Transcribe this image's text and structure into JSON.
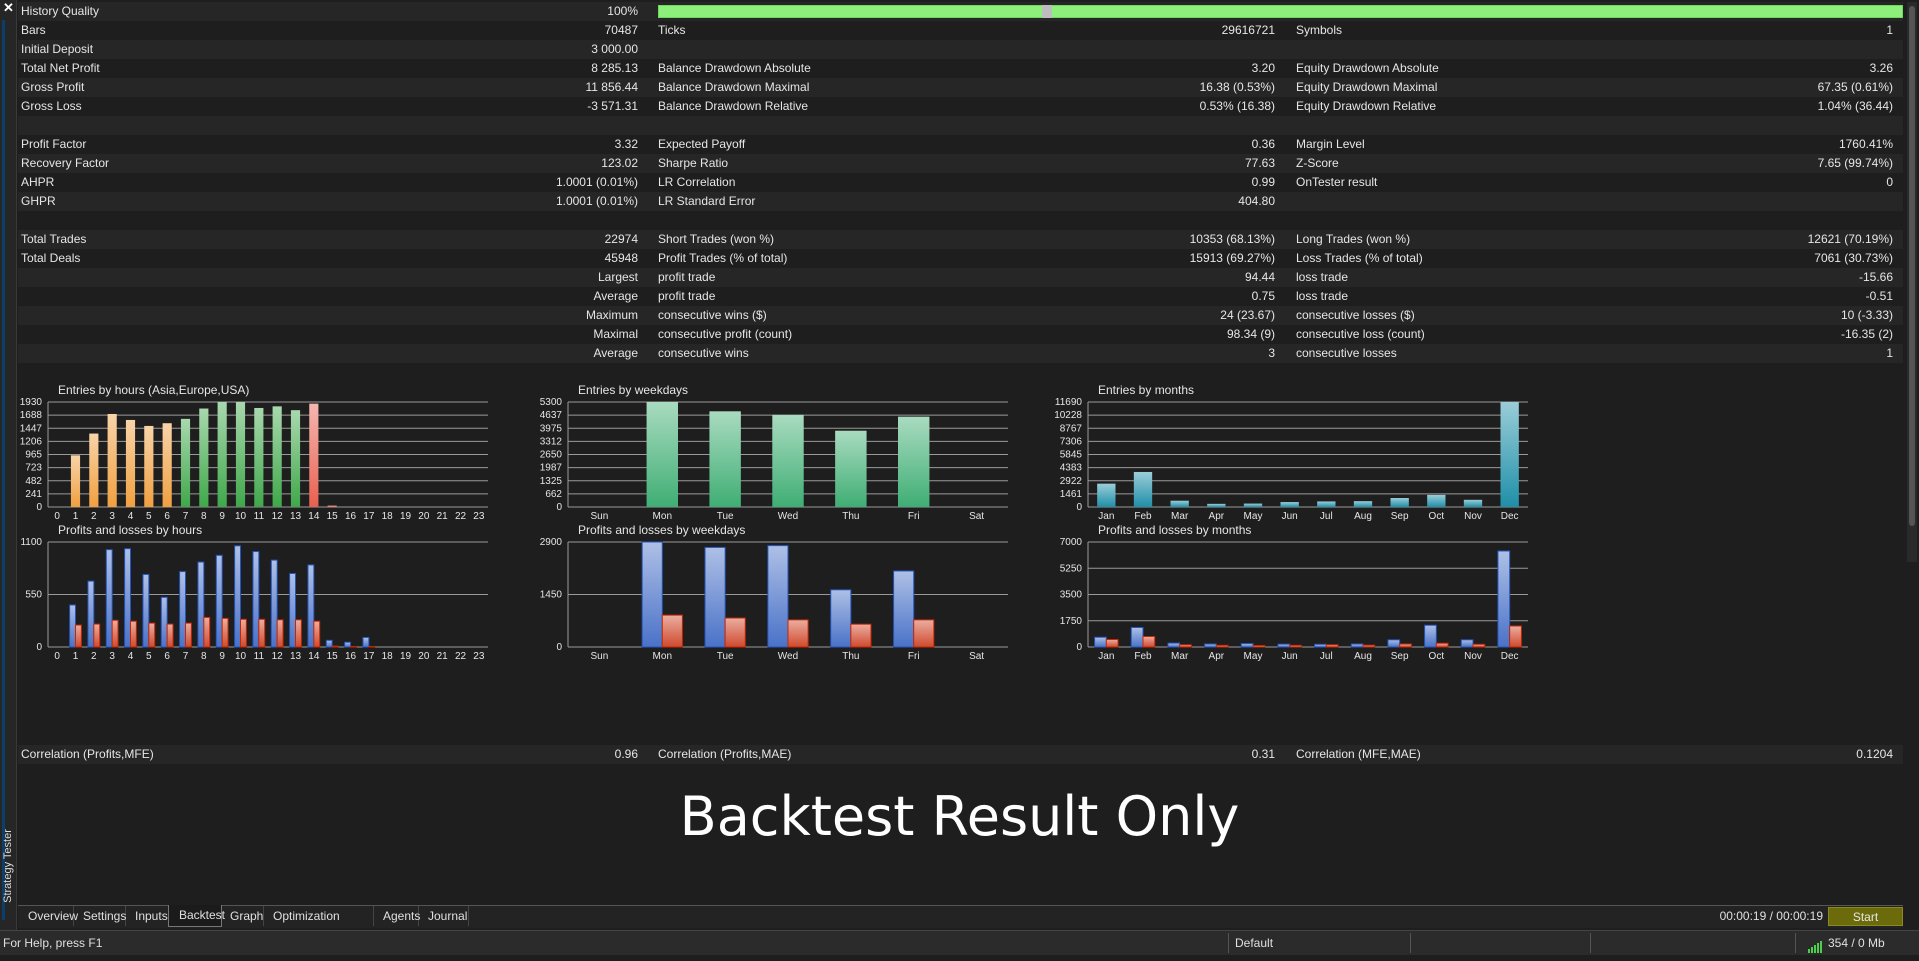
{
  "window": {
    "title": "Strategy Tester",
    "close_glyph": "✕"
  },
  "stats": {
    "rows": [
      {
        "cells": [
          "History Quality",
          "100%",
          "",
          "",
          "",
          ""
        ],
        "alt": true,
        "quality_bar": true,
        "quality_pct": 100
      },
      {
        "cells": [
          "Bars",
          "70487",
          "Ticks",
          "29616721",
          "Symbols",
          "1"
        ],
        "alt": false
      },
      {
        "cells": [
          "Initial Deposit",
          "3 000.00",
          "",
          "",
          "",
          ""
        ],
        "alt": true
      },
      {
        "cells": [
          "Total Net Profit",
          "8 285.13",
          "Balance Drawdown Absolute",
          "3.20",
          "Equity Drawdown Absolute",
          "3.26"
        ],
        "alt": false
      },
      {
        "cells": [
          "Gross Profit",
          "11 856.44",
          "Balance Drawdown Maximal",
          "16.38 (0.53%)",
          "Equity Drawdown Maximal",
          "67.35 (0.61%)"
        ],
        "alt": true
      },
      {
        "cells": [
          "Gross Loss",
          "-3 571.31",
          "Balance Drawdown Relative",
          "0.53% (16.38)",
          "Equity Drawdown Relative",
          "1.04% (36.44)"
        ],
        "alt": false
      },
      {
        "cells": [
          "",
          "",
          "",
          "",
          "",
          ""
        ],
        "alt": true
      },
      {
        "cells": [
          "Profit Factor",
          "3.32",
          "Expected Payoff",
          "0.36",
          "Margin Level",
          "1760.41%"
        ],
        "alt": false
      },
      {
        "cells": [
          "Recovery Factor",
          "123.02",
          "Sharpe Ratio",
          "77.63",
          "Z-Score",
          "7.65 (99.74%)"
        ],
        "alt": true
      },
      {
        "cells": [
          "AHPR",
          "1.0001 (0.01%)",
          "LR Correlation",
          "0.99",
          "OnTester result",
          "0"
        ],
        "alt": false
      },
      {
        "cells": [
          "GHPR",
          "1.0001 (0.01%)",
          "LR Standard Error",
          "404.80",
          "",
          ""
        ],
        "alt": true
      },
      {
        "cells": [
          "",
          "",
          "",
          "",
          "",
          ""
        ],
        "alt": false
      },
      {
        "cells": [
          "Total Trades",
          "22974",
          "Short Trades (won %)",
          "10353 (68.13%)",
          "Long Trades (won %)",
          "12621 (70.19%)"
        ],
        "alt": true
      },
      {
        "cells": [
          "Total Deals",
          "45948",
          "Profit Trades (% of total)",
          "15913 (69.27%)",
          "Loss Trades (% of total)",
          "7061 (30.73%)"
        ],
        "alt": false
      },
      {
        "cells": [
          "",
          "Largest",
          "profit trade",
          "94.44",
          "loss trade",
          "-15.66"
        ],
        "alt": true,
        "right_label": true
      },
      {
        "cells": [
          "",
          "Average",
          "profit trade",
          "0.75",
          "loss trade",
          "-0.51"
        ],
        "alt": false,
        "right_label": true
      },
      {
        "cells": [
          "",
          "Maximum",
          "consecutive wins ($)",
          "24 (23.67)",
          "consecutive losses ($)",
          "10 (-3.33)"
        ],
        "alt": true,
        "right_label": true
      },
      {
        "cells": [
          "",
          "Maximal",
          "consecutive profit (count)",
          "98.34 (9)",
          "consecutive loss (count)",
          "-16.35 (2)"
        ],
        "alt": false,
        "right_label": true
      },
      {
        "cells": [
          "",
          "Average",
          "consecutive wins",
          "3",
          "consecutive losses",
          "1"
        ],
        "alt": true,
        "right_label": true
      },
      {
        "cells": [
          "",
          "",
          "",
          "",
          "",
          ""
        ],
        "alt": false
      }
    ]
  },
  "chart_data": [
    {
      "type": "bar",
      "title": "Entries by hours (Asia,Europe,USA)",
      "categories": [
        "0",
        "1",
        "2",
        "3",
        "4",
        "5",
        "6",
        "7",
        "8",
        "9",
        "10",
        "11",
        "12",
        "13",
        "14",
        "15",
        "16",
        "17",
        "18",
        "19",
        "20",
        "21",
        "22",
        "23"
      ],
      "values": [
        0,
        950,
        1350,
        1710,
        1600,
        1490,
        1540,
        1620,
        1810,
        1930,
        1930,
        1820,
        1850,
        1780,
        1900,
        25,
        0,
        0,
        0,
        0,
        0,
        0,
        0,
        0
      ],
      "yticks": [
        "0",
        "241",
        "482",
        "723",
        "965",
        "1206",
        "1447",
        "1688",
        "1930"
      ],
      "ylim": [
        0,
        1930
      ],
      "colors": [
        "#f0a040",
        "#f0a040",
        "#f0a040",
        "#f0a040",
        "#f0a040",
        "#f0a040",
        "#f0a040",
        "#3fa84a",
        "#3fa84a",
        "#3fa84a",
        "#3fa84a",
        "#3fa84a",
        "#3fa84a",
        "#3fa84a",
        "#e8604f",
        "#e8604f",
        "#e8604f",
        "#e8604f",
        "#e8604f",
        "#e8604f",
        "#e8604f",
        "#e8604f",
        "#e8604f",
        "#e8604f"
      ]
    },
    {
      "type": "bar",
      "title": "Entries by weekdays",
      "categories": [
        "Sun",
        "Mon",
        "Tue",
        "Wed",
        "Thu",
        "Fri",
        "Sat"
      ],
      "values": [
        0,
        5300,
        4830,
        4650,
        3850,
        4560,
        0
      ],
      "yticks": [
        "0",
        "662",
        "1325",
        "1987",
        "2650",
        "3312",
        "3975",
        "4637",
        "5300"
      ],
      "ylim": [
        0,
        5300
      ],
      "colors": [
        "#3fae74",
        "#3fae74",
        "#3fae74",
        "#3fae74",
        "#3fae74",
        "#3fae74",
        "#3fae74"
      ]
    },
    {
      "type": "bar",
      "title": "Entries by months",
      "categories": [
        "Jan",
        "Feb",
        "Mar",
        "Apr",
        "May",
        "Jun",
        "Jul",
        "Aug",
        "Sep",
        "Oct",
        "Nov",
        "Dec"
      ],
      "values": [
        2600,
        3900,
        700,
        350,
        380,
        550,
        620,
        650,
        1000,
        1350,
        800,
        11690
      ],
      "yticks": [
        "0",
        "1461",
        "2922",
        "4383",
        "5845",
        "7306",
        "8767",
        "10228",
        "11690"
      ],
      "ylim": [
        0,
        11690
      ],
      "colors": [
        "#1f8fa8",
        "#1f8fa8",
        "#1f8fa8",
        "#1f8fa8",
        "#1f8fa8",
        "#1f8fa8",
        "#1f8fa8",
        "#1f8fa8",
        "#1f8fa8",
        "#1f8fa8",
        "#1f8fa8",
        "#1f8fa8"
      ]
    },
    {
      "type": "bar",
      "title": "Profits and losses by hours",
      "categories": [
        "0",
        "1",
        "2",
        "3",
        "4",
        "5",
        "6",
        "7",
        "8",
        "9",
        "10",
        "11",
        "12",
        "13",
        "14",
        "15",
        "16",
        "17",
        "18",
        "19",
        "20",
        "21",
        "22",
        "23"
      ],
      "series": [
        {
          "values": [
            0,
            440,
            690,
            1020,
            1030,
            760,
            520,
            790,
            890,
            960,
            1060,
            1000,
            910,
            770,
            860,
            70,
            50,
            100,
            0,
            0,
            0,
            0,
            0,
            0
          ]
        },
        {
          "values": [
            0,
            230,
            240,
            280,
            270,
            250,
            240,
            250,
            310,
            300,
            290,
            290,
            285,
            285,
            270,
            10,
            5,
            5,
            0,
            0,
            0,
            0,
            0,
            0
          ]
        }
      ],
      "yticks": [
        "0",
        "550",
        "1100"
      ],
      "ylim": [
        0,
        1100
      ],
      "colors": [
        "#4a72c8",
        "#d04a2e"
      ]
    },
    {
      "type": "bar",
      "title": "Profits and losses by weekdays",
      "categories": [
        "Sun",
        "Mon",
        "Tue",
        "Wed",
        "Thu",
        "Fri",
        "Sat"
      ],
      "series": [
        {
          "values": [
            0,
            2900,
            2750,
            2800,
            1580,
            2100,
            0
          ]
        },
        {
          "values": [
            0,
            880,
            800,
            750,
            630,
            750,
            0
          ]
        }
      ],
      "yticks": [
        "0",
        "1450",
        "2900"
      ],
      "ylim": [
        0,
        2900
      ],
      "colors": [
        "#4a72c8",
        "#d04a2e"
      ]
    },
    {
      "type": "bar",
      "title": "Profits and losses by months",
      "categories": [
        "Jan",
        "Feb",
        "Mar",
        "Apr",
        "May",
        "Jun",
        "Jul",
        "Aug",
        "Sep",
        "Oct",
        "Nov",
        "Dec"
      ],
      "series": [
        {
          "values": [
            650,
            1300,
            260,
            200,
            230,
            190,
            180,
            200,
            480,
            1450,
            480,
            6400
          ]
        },
        {
          "values": [
            500,
            700,
            150,
            110,
            100,
            110,
            150,
            120,
            200,
            250,
            180,
            1400
          ]
        }
      ],
      "yticks": [
        "0",
        "1750",
        "3500",
        "5250",
        "7000"
      ],
      "ylim": [
        0,
        7000
      ],
      "colors": [
        "#4a72c8",
        "#d04a2e"
      ]
    }
  ],
  "correlation": {
    "label1": "Correlation (Profits,MFE)",
    "value1": "0.96",
    "label2": "Correlation (Profits,MAE)",
    "value2": "0.31",
    "label3": "Correlation (MFE,MAE)",
    "value3": "0.1204"
  },
  "watermark": "Backtest Result Only",
  "tabs": [
    {
      "label": "Overview"
    },
    {
      "label": "Settings"
    },
    {
      "label": "Inputs"
    },
    {
      "label": "Backtest",
      "active": true
    },
    {
      "label": "Graph"
    },
    {
      "label": "Optimization Results"
    },
    {
      "label": "Agents"
    },
    {
      "label": "Journal"
    }
  ],
  "timer": "00:00:19 / 00:00:19",
  "start_label": "Start",
  "status": {
    "help": "For Help, press F1",
    "profile": "Default",
    "connection": "354 / 0 Mb"
  }
}
